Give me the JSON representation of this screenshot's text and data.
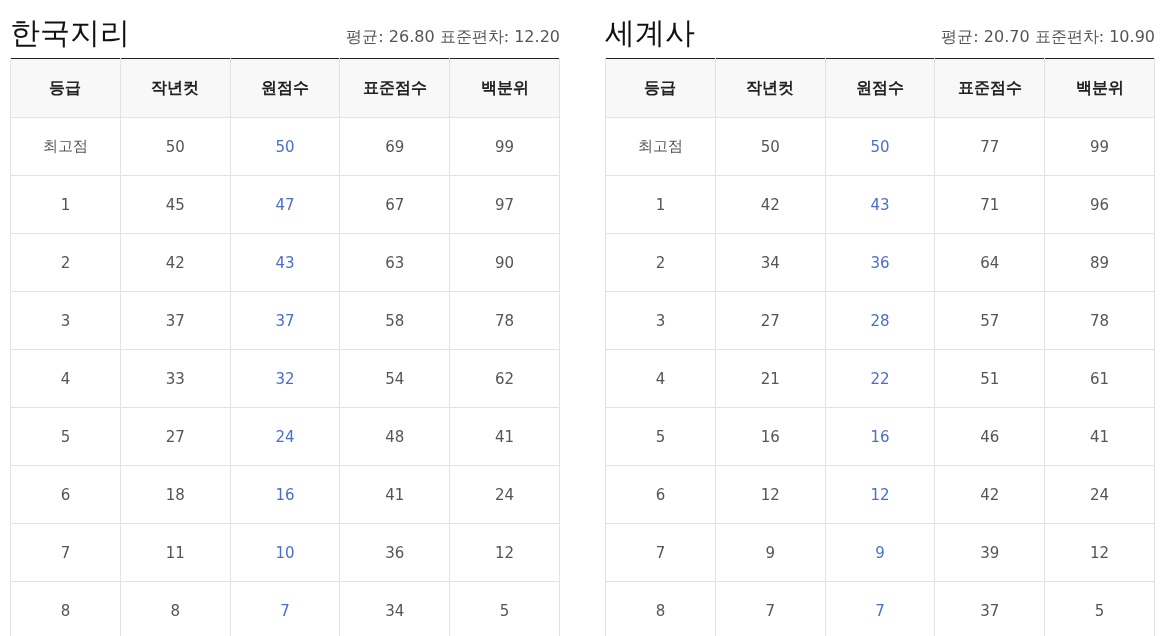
{
  "panels": [
    {
      "title": "한국지리",
      "stats": "평균: 26.80 표준편차: 12.20",
      "columns": [
        {
          "label": "등급",
          "highlighted": false
        },
        {
          "label": "작년컷",
          "highlighted": false
        },
        {
          "label": "원점수",
          "highlighted": true
        },
        {
          "label": "표준점수",
          "highlighted": false
        },
        {
          "label": "백분위",
          "highlighted": false
        }
      ],
      "rows": [
        [
          "최고점",
          "50",
          "50",
          "69",
          "99"
        ],
        [
          "1",
          "45",
          "47",
          "67",
          "97"
        ],
        [
          "2",
          "42",
          "43",
          "63",
          "90"
        ],
        [
          "3",
          "37",
          "37",
          "58",
          "78"
        ],
        [
          "4",
          "33",
          "32",
          "54",
          "62"
        ],
        [
          "5",
          "27",
          "24",
          "48",
          "41"
        ],
        [
          "6",
          "18",
          "16",
          "41",
          "24"
        ],
        [
          "7",
          "11",
          "10",
          "36",
          "12"
        ],
        [
          "8",
          "8",
          "7",
          "34",
          "5"
        ]
      ]
    },
    {
      "title": "세계사",
      "stats": "평균: 20.70 표준편차: 10.90",
      "columns": [
        {
          "label": "등급",
          "highlighted": false
        },
        {
          "label": "작년컷",
          "highlighted": false
        },
        {
          "label": "원점수",
          "highlighted": true
        },
        {
          "label": "표준점수",
          "highlighted": false
        },
        {
          "label": "백분위",
          "highlighted": false
        }
      ],
      "rows": [
        [
          "최고점",
          "50",
          "50",
          "77",
          "99"
        ],
        [
          "1",
          "42",
          "43",
          "71",
          "96"
        ],
        [
          "2",
          "34",
          "36",
          "64",
          "89"
        ],
        [
          "3",
          "27",
          "28",
          "57",
          "78"
        ],
        [
          "4",
          "21",
          "22",
          "51",
          "61"
        ],
        [
          "5",
          "16",
          "16",
          "46",
          "41"
        ],
        [
          "6",
          "12",
          "12",
          "42",
          "24"
        ],
        [
          "7",
          "9",
          "9",
          "39",
          "12"
        ],
        [
          "8",
          "7",
          "7",
          "37",
          "5"
        ]
      ]
    }
  ]
}
